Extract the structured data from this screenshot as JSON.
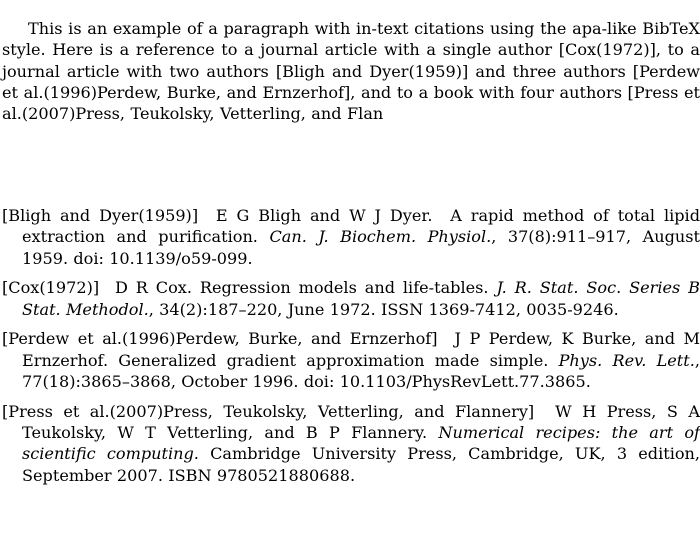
{
  "document": {
    "style_name": "apa-like BibTeX style",
    "background_color": "#ffffff",
    "text_color": "#000000"
  },
  "intro": {
    "text": "This is an example of a paragraph with in-text citations using the apa-like BibTeX style. Here is a reference to a journal article with a single author [Cox(1972)], to a journal article with two authors [Bligh and Dyer(1959)] and three authors [Perdew et al.(1996)Perdew, Burke, and Ernzerhof], and to a book with four authors [Press et al.(2007)Press, Teukolsky, Vetterling, and Flan"
  },
  "bibliography": {
    "entries": [
      {
        "label": "[Bligh and Dyer(1959)]",
        "authors": "E G Bligh and W J Dyer.",
        "title": "A rapid method of total lipid extraction and purification.",
        "venue": "Can. J. Biochem. Physiol.",
        "volume_pages": ", 37(8):911–917, August 1959.",
        "identifier": "doi: 10.1139/o59-099."
      },
      {
        "label": "[Cox(1972)]",
        "authors": "D R Cox.",
        "title": "Regression models and life-tables.",
        "venue": "J. R. Stat. Soc. Series B Stat. Methodol.",
        "volume_pages": ", 34(2):187–220, June 1972.",
        "identifier": "ISSN 1369-7412, 0035-9246."
      },
      {
        "label": "[Perdew et al.(1996)Perdew, Burke, and Ernzerhof]",
        "authors": "J P Perdew, K Burke, and M Ernzerhof.",
        "title": "Generalized gradient approximation made simple.",
        "venue": "Phys. Rev. Lett.",
        "volume_pages": ", 77(18):3865–3868, October 1996.",
        "identifier": "doi: 10.1103/PhysRevLett.77.3865."
      },
      {
        "label": "[Press et al.(2007)Press, Teukolsky, Vetterling, and Flannery]",
        "authors": "W H Press, S A Teukolsky, W T Vetterling, and B P Flannery.",
        "title": "",
        "venue": "Numerical recipes: the art of scientific computing.",
        "volume_pages": " Cambridge University Press, Cambridge, UK, 3 edition, September 2007.",
        "identifier": "ISBN 9780521880688."
      }
    ]
  }
}
